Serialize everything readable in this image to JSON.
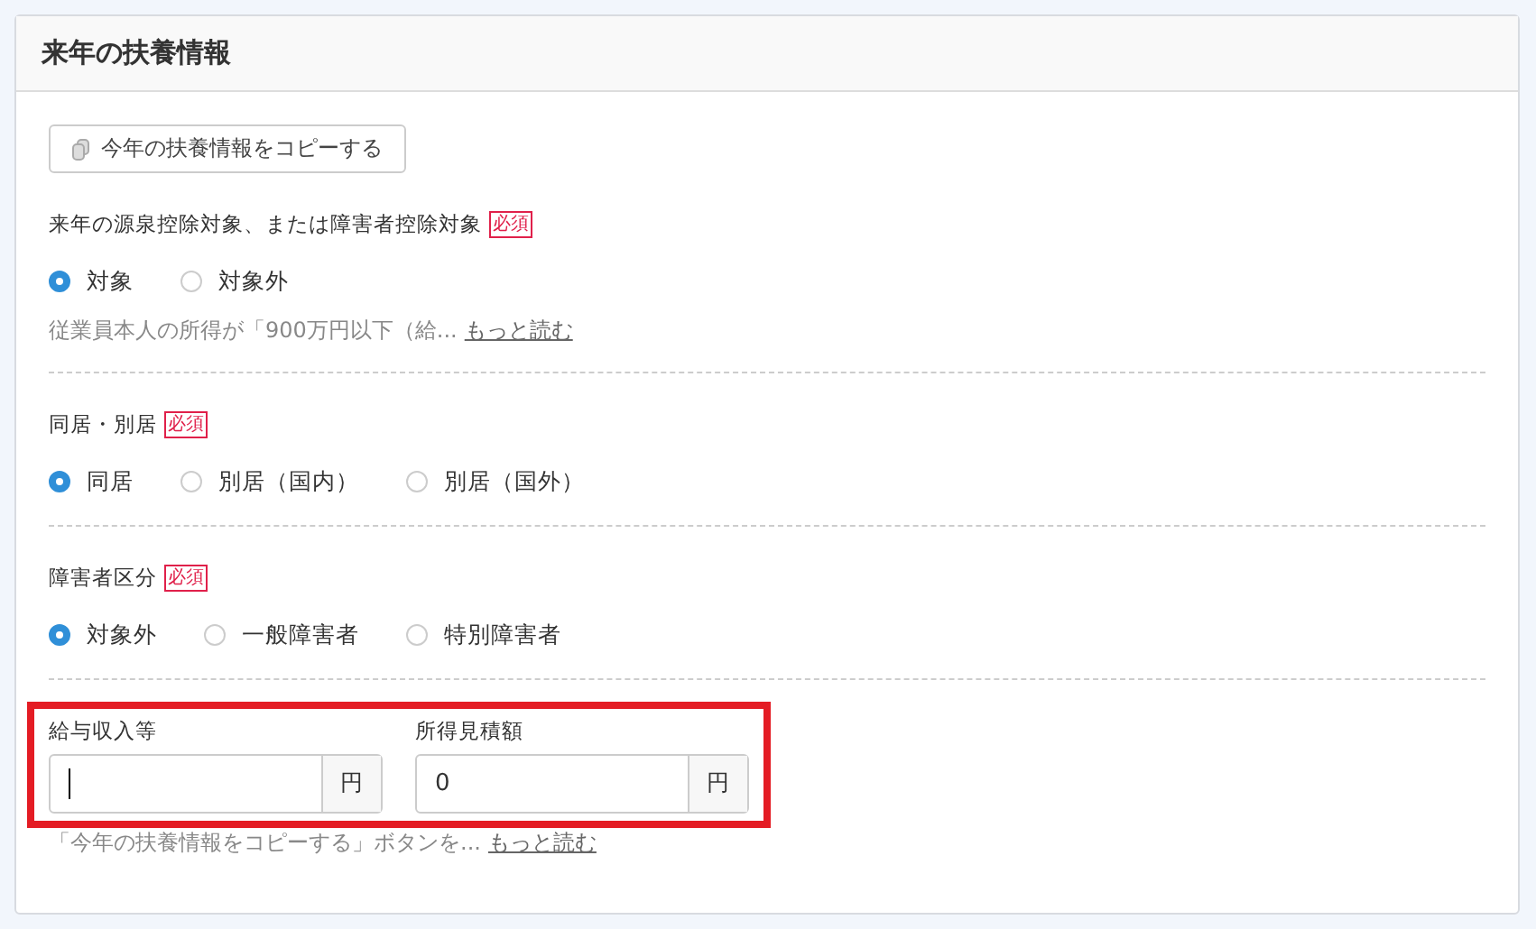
{
  "panel": {
    "title": "来年の扶養情報"
  },
  "copy_button": {
    "label": "今年の扶養情報をコピーする"
  },
  "sections": [
    {
      "label": "来年の源泉控除対象、または障害者控除対象",
      "required_badge": "必須",
      "options": [
        {
          "label": "対象",
          "selected": true
        },
        {
          "label": "対象外",
          "selected": false
        }
      ],
      "hint": "従業員本人の所得が「900万円以下（給...",
      "more_link": "もっと読む"
    },
    {
      "label": "同居・別居",
      "required_badge": "必須",
      "options": [
        {
          "label": "同居",
          "selected": true
        },
        {
          "label": "別居（国内）",
          "selected": false
        },
        {
          "label": "別居（国外）",
          "selected": false
        }
      ]
    },
    {
      "label": "障害者区分",
      "required_badge": "必須",
      "options": [
        {
          "label": "対象外",
          "selected": true
        },
        {
          "label": "一般障害者",
          "selected": false
        },
        {
          "label": "特別障害者",
          "selected": false
        }
      ]
    }
  ],
  "income": {
    "highlighted": true,
    "fields": [
      {
        "label": "給与収入等",
        "focused": true,
        "unit": "円"
      },
      {
        "label": "所得見積額",
        "value": "0",
        "focused": false,
        "unit": "円"
      }
    ],
    "hint": "「今年の扶養情報をコピーする」ボタンを...",
    "more_link": "もっと読む"
  }
}
